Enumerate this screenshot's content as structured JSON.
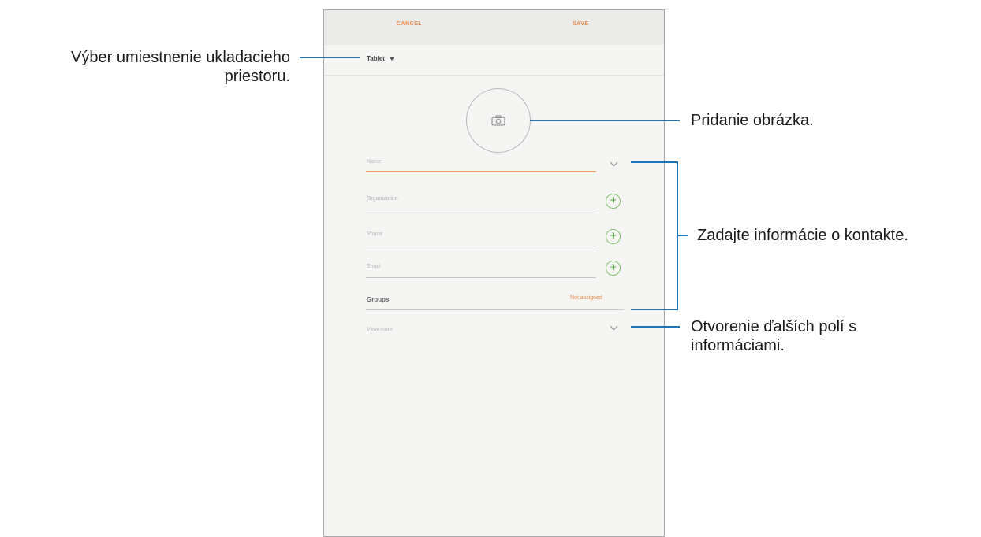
{
  "app": {
    "top_bar": {
      "cancel_label": "CANCEL",
      "save_label": "SAVE"
    },
    "storage": {
      "label": "Tablet"
    },
    "photo": {
      "icon": "camera-icon"
    },
    "fields": {
      "name": {
        "placeholder": "Name"
      },
      "organization": {
        "placeholder": "Organization"
      },
      "phone": {
        "placeholder": "Phone"
      },
      "email": {
        "placeholder": "Email"
      }
    },
    "groups": {
      "label": "Groups",
      "value": "Not assigned"
    },
    "view_more": {
      "label": "View more"
    }
  },
  "annotations": {
    "storage_line1": "Výber umiestnenie ukladacieho",
    "storage_line2": "priestoru.",
    "photo": "Pridanie obrázka.",
    "contact": "Zadajte informácie o kontakte.",
    "more_line1": "Otvorenie ďalších polí s",
    "more_line2": "informáciami."
  },
  "colors": {
    "accent": "#e8894a",
    "annotation_line": "#1d73b3",
    "add_icon": "#58b34a"
  }
}
